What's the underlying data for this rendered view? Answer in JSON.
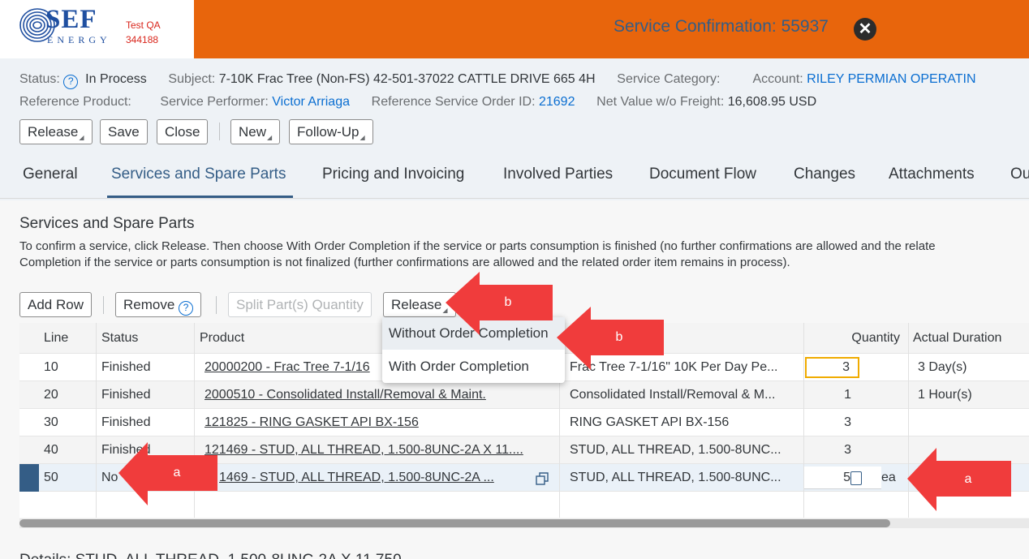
{
  "header": {
    "logo_text": "SEF",
    "logo_sub": "ENERGY",
    "env_line1": "Test QA",
    "env_line2": "344188",
    "title": "Service Confirmation: 55937",
    "close_glyph": "✕",
    "brand_color": "#e8650c"
  },
  "status": {
    "status_label": "Status:",
    "status_help": "?",
    "status_value": "In Process",
    "subject_label": "Subject:",
    "subject_value": "7-10K Frac Tree (Non-FS)  42-501-37022 CATTLE DRIVE 665 4H",
    "category_label": "Service Category:",
    "account_label": "Account:",
    "account_value": "RILEY PERMIAN OPERATIN",
    "ref_product_label": "Reference Product:",
    "performer_label": "Service Performer:",
    "performer_value": "Victor Arriaga",
    "ref_order_label": "Reference Service Order ID:",
    "ref_order_value": "21692",
    "net_value_label": "Net Value w/o Freight:",
    "net_value_value": "16,608.95 USD"
  },
  "toolbar": {
    "release": "Release",
    "save": "Save",
    "close": "Close",
    "new": "New",
    "follow_up": "Follow-Up"
  },
  "tabs": [
    {
      "label": "General"
    },
    {
      "label": "Services and Spare Parts"
    },
    {
      "label": "Pricing and Invoicing"
    },
    {
      "label": "Involved Parties"
    },
    {
      "label": "Document Flow"
    },
    {
      "label": "Changes"
    },
    {
      "label": "Attachments"
    },
    {
      "label": "Ou"
    }
  ],
  "section": {
    "title": "Services and Spare Parts",
    "desc_line1": "To confirm a service, click Release. Then choose With Order Completion if the service or parts consumption is finished (no further confirmations are allowed and the relate",
    "desc_line2": "Completion if the service or parts consumption is not finalized (further confirmations are allowed and the related order item remains in process)."
  },
  "table_toolbar": {
    "add_row": "Add Row",
    "remove": "Remove",
    "remove_help": "?",
    "split": "Split Part(s) Quantity",
    "release": "Release"
  },
  "table": {
    "headers": {
      "line": "Line",
      "status": "Status",
      "product": "Product",
      "quantity": "Quantity",
      "duration": "Actual Duration"
    },
    "rows": [
      {
        "line": "10",
        "status": "Finished",
        "product": "20000200 - Frac Tree 7-1/16",
        "description": "Frac Tree 7-1/16\" 10K Per Day Pe...",
        "quantity": "3",
        "unit": "",
        "duration": "3 Day(s)"
      },
      {
        "line": "20",
        "status": "Finished",
        "product": "2000510 - Consolidated Install/Removal & Maint.",
        "description": "Consolidated Install/Removal & M...",
        "quantity": "1",
        "unit": "",
        "duration": "1 Hour(s)"
      },
      {
        "line": "30",
        "status": "Finished",
        "product": "121825 - RING GASKET API BX-156",
        "description": "RING GASKET API BX-156",
        "quantity": "3",
        "unit": "",
        "duration": ""
      },
      {
        "line": "40",
        "status": "Finished",
        "product": "121469 - STUD, ALL THREAD, 1.500-8UNC-2A X 11....",
        "description": "STUD, ALL THREAD, 1.500-8UNC...",
        "quantity": "3",
        "unit": "",
        "duration": ""
      },
      {
        "line": "50",
        "status": "No",
        "product": "1469 - STUD, ALL THREAD, 1.500-8UNC-2A ...",
        "description": "STUD, ALL THREAD, 1.500-8UNC...",
        "quantity": "5",
        "unit": "ea",
        "duration": ""
      }
    ]
  },
  "dropdown": {
    "item1": "Without Order Completion",
    "item2": "With Order Completion"
  },
  "annotations": {
    "a": "a",
    "b": "b",
    "color": "#f03c3c"
  },
  "details": {
    "text": "Details: STUD, ALL THREAD, 1.500-8UNC-2A X 11.750"
  }
}
